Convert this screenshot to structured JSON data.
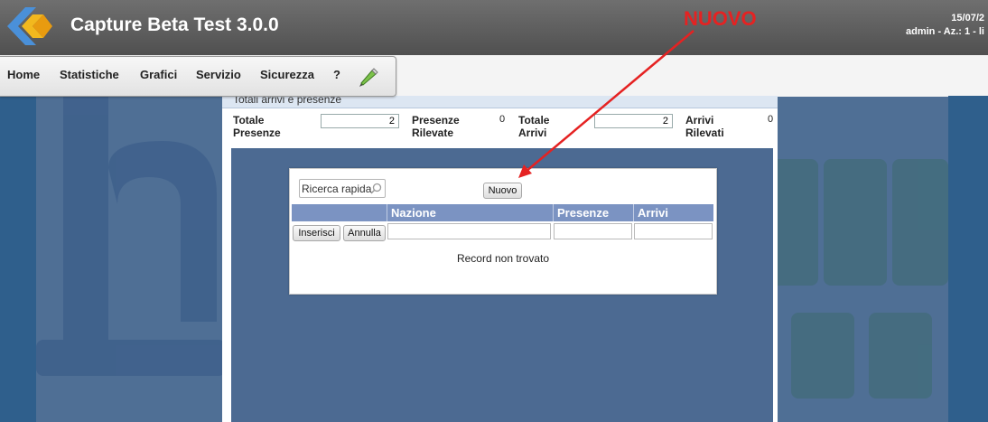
{
  "header": {
    "title": "Capture Beta Test 3.0.0",
    "date": "15/07/2",
    "user_info": "admin - Az.: 1 - li"
  },
  "menu": {
    "items": [
      "Home",
      "Statistiche",
      "Grafici",
      "Servizio",
      "Sicurezza",
      "?"
    ],
    "edit_icon": "pencil-icon"
  },
  "panel": {
    "title": "Totali arrivi e presenze",
    "totale_presenze_label": "Totale Presenze",
    "totale_presenze_value": "2",
    "presenze_rilevate_label": "Presenze Rilevate",
    "presenze_rilevate_value": "0",
    "totale_arrivi_label": "Totale Arrivi",
    "totale_arrivi_value": "2",
    "arrivi_rilevati_label": "Arrivi Rilevati",
    "arrivi_rilevati_value": "0"
  },
  "dialog": {
    "search_placeholder": "Ricerca rapida",
    "new_button": "Nuovo",
    "columns": [
      "Nazione",
      "Presenze",
      "Arrivi"
    ],
    "insert_button": "Inserisci",
    "cancel_button": "Annulla",
    "empty_message": "Record non trovato"
  },
  "annotation": {
    "label": "NUOVO",
    "color": "#e52222"
  },
  "colors": {
    "header_bg": "#5a5a5a",
    "table_header": "#7b93c2",
    "background_blue": "#4f6f95"
  }
}
